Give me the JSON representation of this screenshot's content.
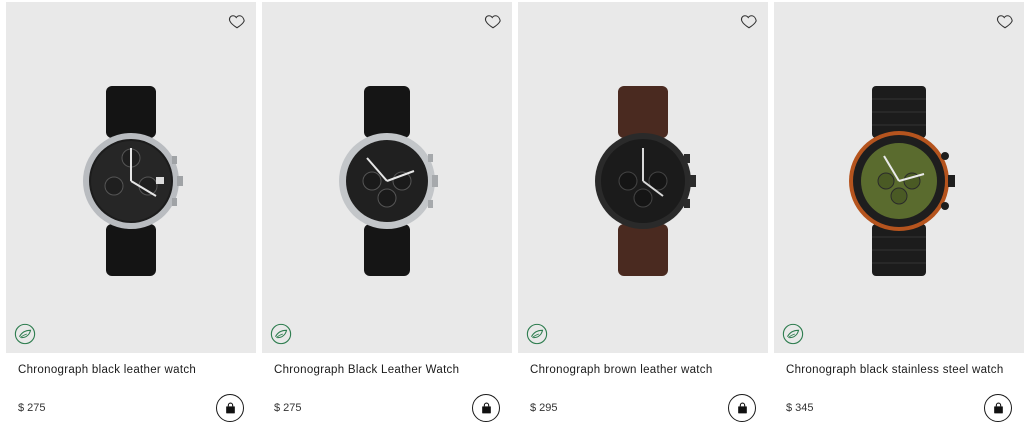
{
  "products": [
    {
      "title": "Chronograph black leather watch",
      "price": "$ 275"
    },
    {
      "title": "Chronograph Black Leather Watch",
      "price": "$ 275"
    },
    {
      "title": "Chronograph brown leather watch",
      "price": "$ 295"
    },
    {
      "title": "Chronograph black stainless steel watch",
      "price": "$ 345"
    }
  ],
  "icons": {
    "wishlist": "heart-outline-icon",
    "eco_badge": "leaf-badge-icon",
    "add_to_bag": "shopping-bag-icon"
  },
  "colors": {
    "card_bg": "#e9e9e9",
    "eco_green": "#2e7d4f",
    "text": "#1a1a1a"
  }
}
